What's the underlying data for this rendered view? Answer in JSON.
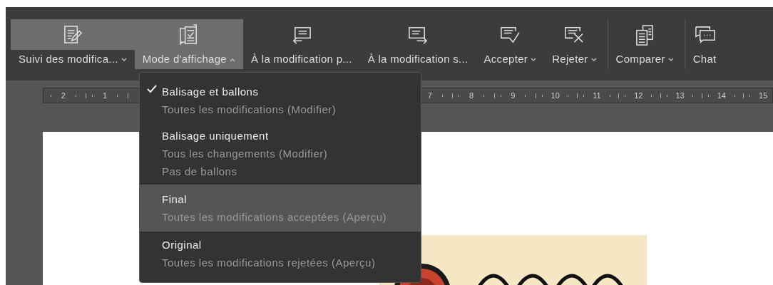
{
  "toolbar": {
    "buttons": [
      {
        "kind": "edit",
        "label": "Suivi des modifica...",
        "caret": true,
        "hover": true,
        "open": false,
        "separator_before": false
      },
      {
        "kind": "display",
        "label": "Mode d'affichage",
        "caret": true,
        "hover": false,
        "open": true,
        "separator_before": false
      },
      {
        "kind": "previous",
        "label": "À la modification p...",
        "caret": false,
        "hover": false,
        "open": false,
        "separator_before": false
      },
      {
        "kind": "next",
        "label": "À la modification s...",
        "caret": false,
        "hover": false,
        "open": false,
        "separator_before": false
      },
      {
        "kind": "accept",
        "label": "Accepter",
        "caret": true,
        "hover": false,
        "open": false,
        "separator_before": false
      },
      {
        "kind": "reject",
        "label": "Rejeter",
        "caret": true,
        "hover": false,
        "open": false,
        "separator_before": false
      },
      {
        "kind": "compare",
        "label": "Comparer",
        "caret": true,
        "hover": false,
        "open": false,
        "separator_before": true
      },
      {
        "kind": "chat",
        "label": "Chat",
        "caret": false,
        "hover": false,
        "open": false,
        "separator_before": true
      }
    ]
  },
  "ruler": {
    "left_labels": [
      "2",
      "1"
    ],
    "right_labels": [
      "7",
      "8",
      "9",
      "10",
      "11",
      "12",
      "13",
      "14",
      "15"
    ]
  },
  "display_menu": {
    "items": [
      {
        "title": "Balisage et ballons",
        "lines": [
          "Toutes les modifications (Modifier)"
        ],
        "checked": true,
        "highlighted": false
      },
      {
        "title": "Balisage uniquement",
        "lines": [
          "Tous les changements (Modifier)",
          "Pas de ballons"
        ],
        "checked": false,
        "highlighted": false
      },
      {
        "title": "Final",
        "lines": [
          "Toutes les modifications acceptées (Aperçu)"
        ],
        "checked": false,
        "highlighted": true
      },
      {
        "title": "Original",
        "lines": [
          "Toutes les modifications rejetées (Aperçu)"
        ],
        "checked": false,
        "highlighted": false
      }
    ]
  }
}
